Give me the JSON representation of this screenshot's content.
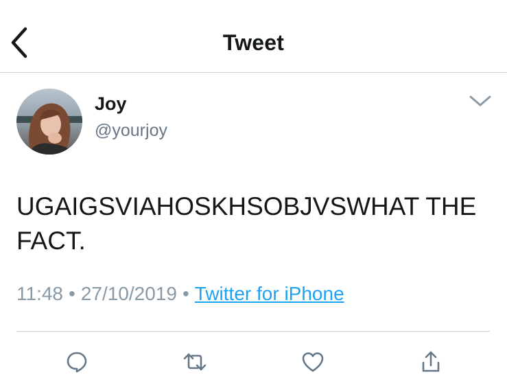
{
  "header": {
    "title": "Tweet",
    "back_icon": "chevron-left-icon"
  },
  "author": {
    "name": "Joy",
    "handle": "@yourjoy",
    "avatar_icon": "avatar"
  },
  "tweet": {
    "text": "UGAIGSVIAHOSKHSOBJVSWHAT THE FACT.",
    "time": "11:48",
    "date": "27/10/2019",
    "separator": "•",
    "source": "Twitter for iPhone"
  },
  "actions": {
    "reply_icon": "reply-icon",
    "retweet_icon": "retweet-icon",
    "like_icon": "heart-icon",
    "share_icon": "share-icon",
    "more_icon": "chevron-down-icon"
  },
  "colors": {
    "accent": "#1da1f2",
    "text": "#14171a",
    "muted": "#657786",
    "meta": "#8899a6",
    "icon": "#657786"
  }
}
